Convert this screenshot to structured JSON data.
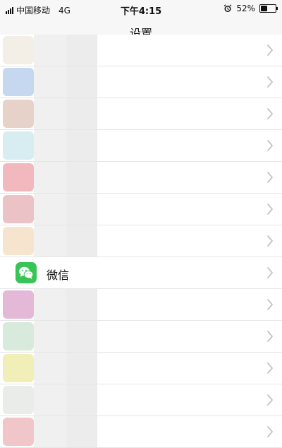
{
  "status_bar": {
    "carrier": "中国移动",
    "network": "4G",
    "time": "下午4:15",
    "battery": "52%",
    "battery_level": 0.52
  },
  "nav": {
    "title": "设置"
  },
  "rows": [
    {
      "icon_color": "#f3efe6"
    },
    {
      "icon_color": "#c5d8f0"
    },
    {
      "icon_color": "#e6d2c8"
    },
    {
      "icon_color": "#d7edf1"
    },
    {
      "icon_color": "#f1b9bd"
    },
    {
      "icon_color": "#ebc3c6"
    },
    {
      "icon_color": "#f6e4cf"
    },
    {
      "label": "微信",
      "icon": "wechat-icon",
      "icon_color": "#38c456"
    },
    {
      "icon_color": "#e3b9d7"
    },
    {
      "icon_color": "#d7eadc"
    },
    {
      "icon_color": "#f1eeb8"
    },
    {
      "icon_color": "#e9ece8"
    },
    {
      "icon_color": "#f0c6c9"
    }
  ],
  "colors": {
    "chevron": "#c4c4c4",
    "wechat_green": "#38c456"
  }
}
